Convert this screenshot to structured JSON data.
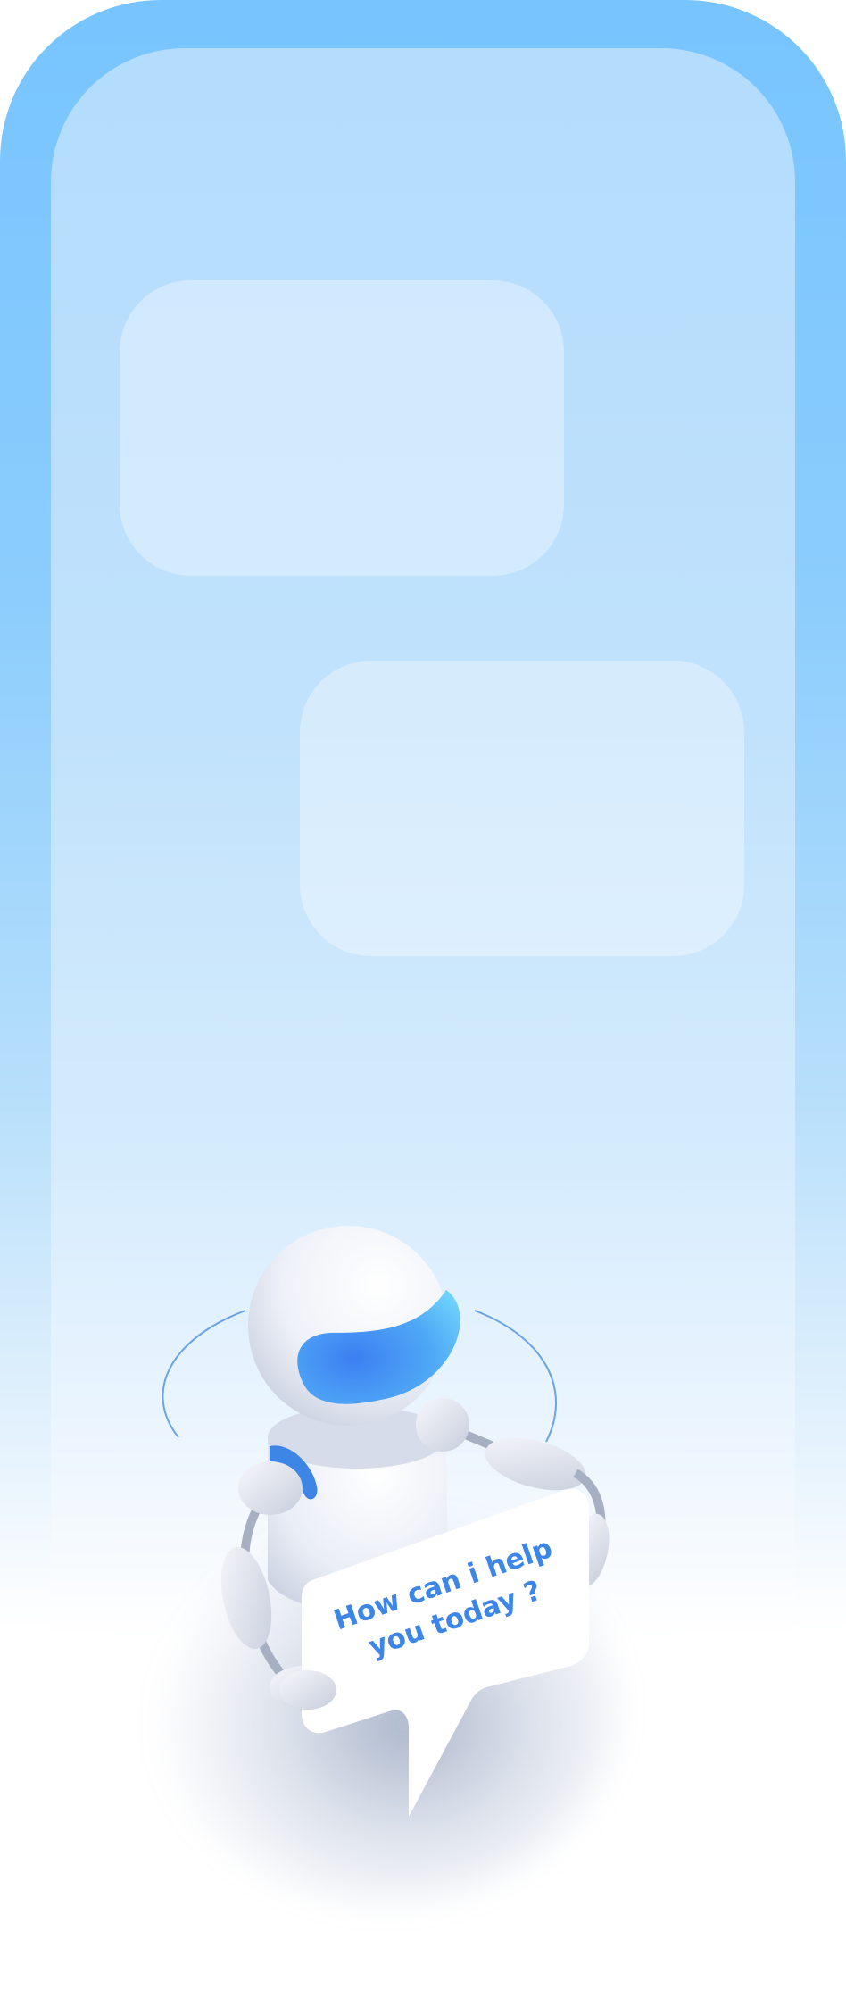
{
  "bubble": {
    "line1": "How can i help",
    "line2": "you today ?"
  },
  "colors": {
    "frame": "#77c4fe",
    "inner": "#b3dcfd",
    "visor": "#4a9ff5",
    "accent_text": "#3d86e6"
  },
  "icons": {
    "robot": "robot-mascot",
    "bubble": "speech-bubble"
  }
}
